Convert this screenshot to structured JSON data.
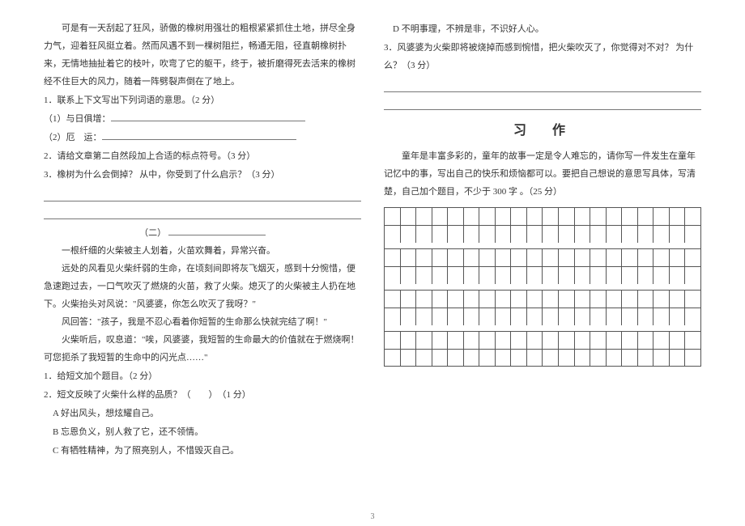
{
  "page_number": "3",
  "left": {
    "p1": "可是有一天刮起了狂风，骄傲的橡树用强壮的粗根紧紧抓住土地，拼尽全身力气，迎着狂风挺立着。然而风遇不到一棵树阻拦，畅通无阻，径直朝橡树扑来，无情地抽扯着它的枝叶，吹弯了它的躯干，终于，被折磨得死去活来的橡树经不住巨大的风力，随着一阵劈裂声倒在了地上。",
    "q1": "1．联系上下文写出下列词语的意思。（2 分）",
    "q1a_label": "（1）与日俱增：",
    "q1b_label": "（2）厄　运：",
    "q2": "2．请给文章第二自然段加上合适的标点符号。（3 分）",
    "q3": "3．橡树为什么会倒掉？ 从中，你受到了什么启示？（3 分）",
    "section2_label": "（二）",
    "p2a": "一根纤细的火柴被主人划着，火苗欢舞着，异常兴奋。",
    "p2b": "远处的风看见火柴纤弱的生命，在顷刻间即将灰飞烟灭，感到十分惋惜，便急速跑过去，一口气吹灭了燃烧的火苗，救了火柴。熄灭了的火柴被主人扔在地下。火柴抬头对风说：\"风婆婆，你怎么吹灭了我呀？\"",
    "p2c": "风回答：\"孩子，我是不忍心看着你短暂的生命那么快就完结了啊！\"",
    "p2d": "火柴听后，叹息道：\"唉，风婆婆，我短暂的生命最大的价值就在于燃烧啊！可您扼杀了我短暂的生命中的闪光点……\"",
    "s2q1": "1．给短文加个题目。（2 分）",
    "s2q2": "2．短文反映了火柴什么样的品质？（　　）　（1 分）",
    "optA": "A 好出风头，想炫耀自己。",
    "optB": "B 忘恩负义，别人救了它，还不领情。",
    "optC": "C 有牺牲精神，为了照亮别人，不惜毁灭自己。"
  },
  "right": {
    "optD": "D 不明事理，不辨是非，不识好人心。",
    "s2q3": "3．风婆婆为火柴即将被烧掉而感到惋惜，把火柴吹灭了，你觉得对不对？ 为什么？（3 分）",
    "essay_title": "习　作",
    "essay_prompt": "童年是丰富多彩的，童年的故事一定是令人难忘的，请你写一件发生在童年记忆中的事，写出自己的快乐和烦恼都可以。要把自己想说的意思写具体，写清楚，自己加个题目，不少于 300 字 。（25 分）"
  },
  "grid": {
    "cols": 20,
    "groups": 4,
    "rows_per_group": 2
  }
}
